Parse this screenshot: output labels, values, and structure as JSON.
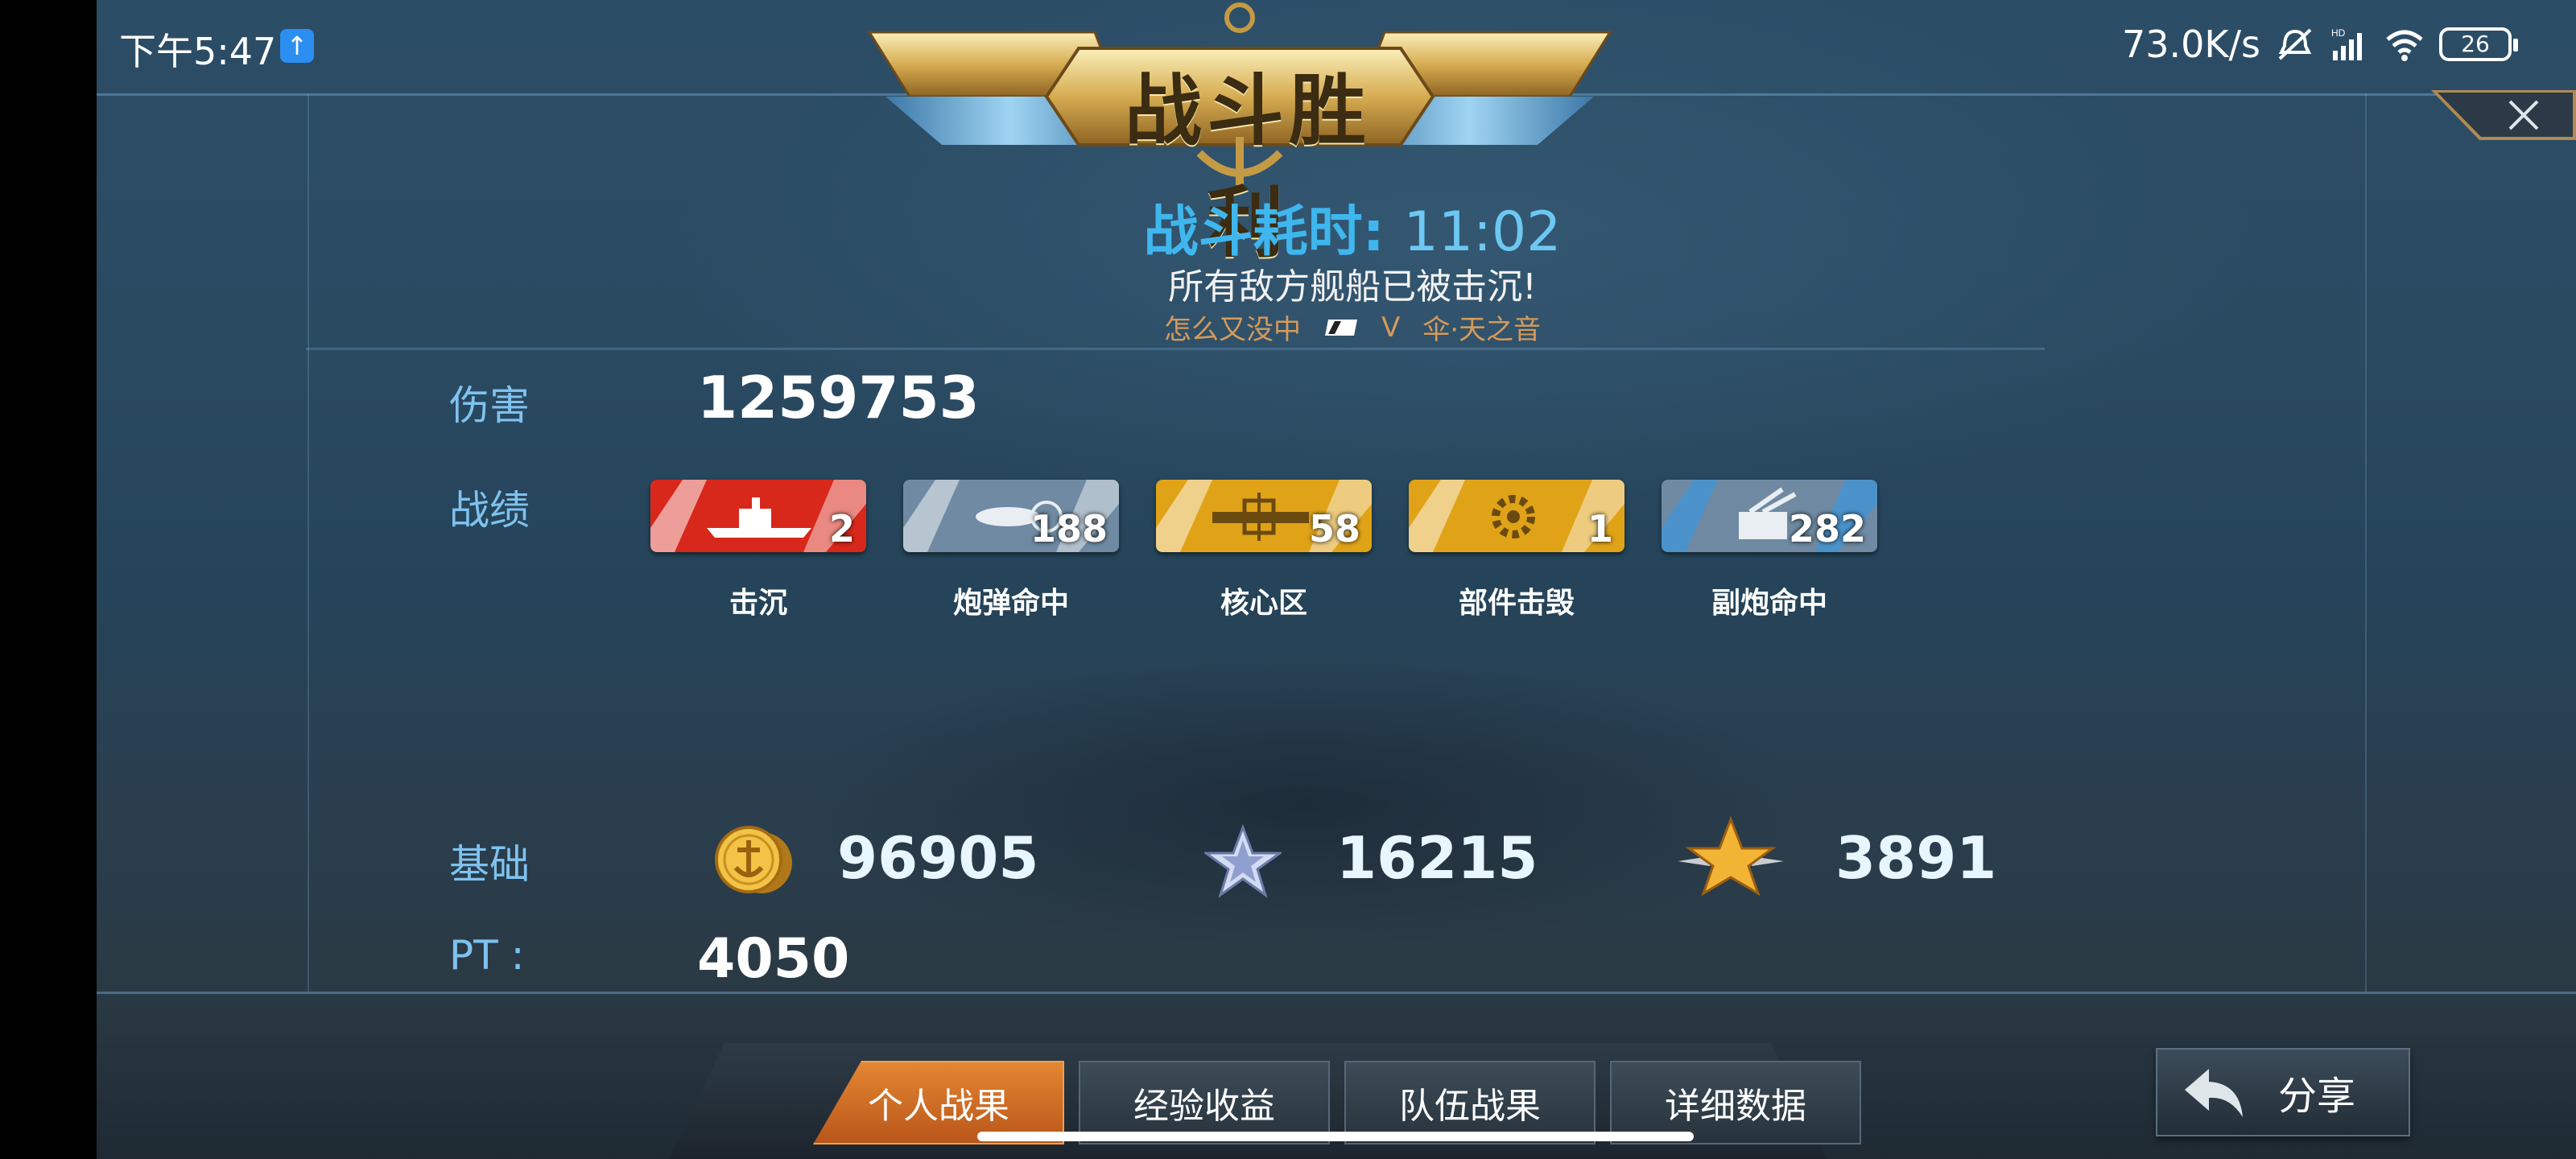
{
  "status_bar": {
    "time": "下午5:47",
    "upload_icon": "upload-arrow-icon",
    "net_speed": "73.0K/s",
    "battery": "26",
    "icons": [
      "mute-bell-icon",
      "hd-signal-icon",
      "wifi-icon",
      "battery-icon"
    ]
  },
  "banner": {
    "title": "战斗胜利"
  },
  "summary": {
    "duration_label": "战斗耗时:",
    "duration_value": "11:02",
    "message": "所有敌方舰船已被击沉!",
    "player_left": "怎么又没中",
    "vs": "V",
    "player_right": "伞·天之音"
  },
  "damage": {
    "label": "伤害",
    "value": "1259753"
  },
  "record": {
    "label": "战绩",
    "badges": [
      {
        "label": "击沉",
        "count": "2",
        "color": "#d8281c",
        "icon": "warship-icon"
      },
      {
        "label": "炮弹命中",
        "count": "188",
        "color": "#6f8aa2",
        "icon": "shell-icon"
      },
      {
        "label": "核心区",
        "count": "58",
        "color": "#e0a317",
        "icon": "crosshair-icon"
      },
      {
        "label": "部件击毁",
        "count": "1",
        "color": "#e0a317",
        "icon": "gear-icon"
      },
      {
        "label": "副炮命中",
        "count": "282",
        "color": "#6f8aa2",
        "icon": "turret-icon"
      }
    ]
  },
  "base": {
    "label": "基础",
    "coins": "96905",
    "exp": "16215",
    "gold_star": "3891"
  },
  "pt": {
    "label": "PT :",
    "value": "4050"
  },
  "tabs": [
    {
      "label": "个人战果",
      "active": true
    },
    {
      "label": "经验收益",
      "active": false
    },
    {
      "label": "队伍战果",
      "active": false
    },
    {
      "label": "详细数据",
      "active": false
    }
  ],
  "share": {
    "label": "分享"
  }
}
